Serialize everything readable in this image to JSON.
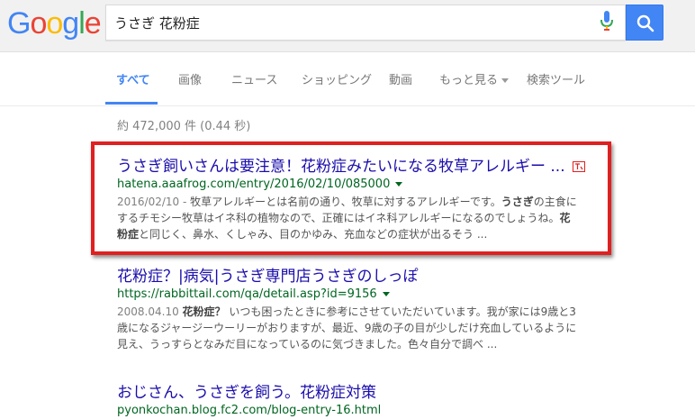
{
  "logo": {
    "letters": [
      "G",
      "o",
      "o",
      "g",
      "l",
      "e"
    ],
    "colors": [
      "#4285f4",
      "#ea4335",
      "#fbbc05",
      "#4285f4",
      "#34a853",
      "#ea4335"
    ]
  },
  "search": {
    "query": "うさぎ 花粉症"
  },
  "tabs": [
    {
      "label": "すべて",
      "active": true
    },
    {
      "label": "画像"
    },
    {
      "label": "ニュース"
    },
    {
      "label": "ショッピング"
    },
    {
      "label": "動画"
    },
    {
      "label": "もっと見る"
    },
    {
      "label": "検索ツール"
    }
  ],
  "stats": "約 472,000 件 (0.44 秒)",
  "results": [
    {
      "title": "うさぎ飼いさんは要注意！花粉症みたいになる牧草アレルギー ...",
      "url": "hatena.aaafrog.com/entry/2016/02/10/085000",
      "date": "2016/02/10 - ",
      "s1": "牧草アレルギーとは名前の通り、牧草に対するアレルギーです。",
      "b1": "うさぎ",
      "s2": "の主食に",
      "s3": "するチモシー牧草はイネ科の植物なので、正確にはイネ科アレルギーになるのでしょうね。",
      "b2": "花",
      "b3": "粉症",
      "s4": "と同じく、鼻水、くしゃみ、目のかゆみ、充血などの症状が出るそう ..."
    },
    {
      "title": "花粉症？|病気|うさぎ専門店うさぎのしっぽ",
      "url": "https://rabbittail.com/qa/detail.asp?id=9156",
      "date": "2008.04.10 ",
      "b1": "花粉症？",
      "s1": " いつも困ったときに参考にさせていただいています。我が家には9歳と3",
      "s2": "歳になるジャージーウーリーがおりますが、最近、9歳の子の目が少しだけ充血しているように",
      "s3": "見え、うっすらとなみだ目になっているのに気づきました。色々自分で調べ ..."
    },
    {
      "title": "おじさん、うさぎを飼う。花粉症対策",
      "url": "pyonkochan.blog.fc2.com/blog-entry-16.html"
    }
  ]
}
